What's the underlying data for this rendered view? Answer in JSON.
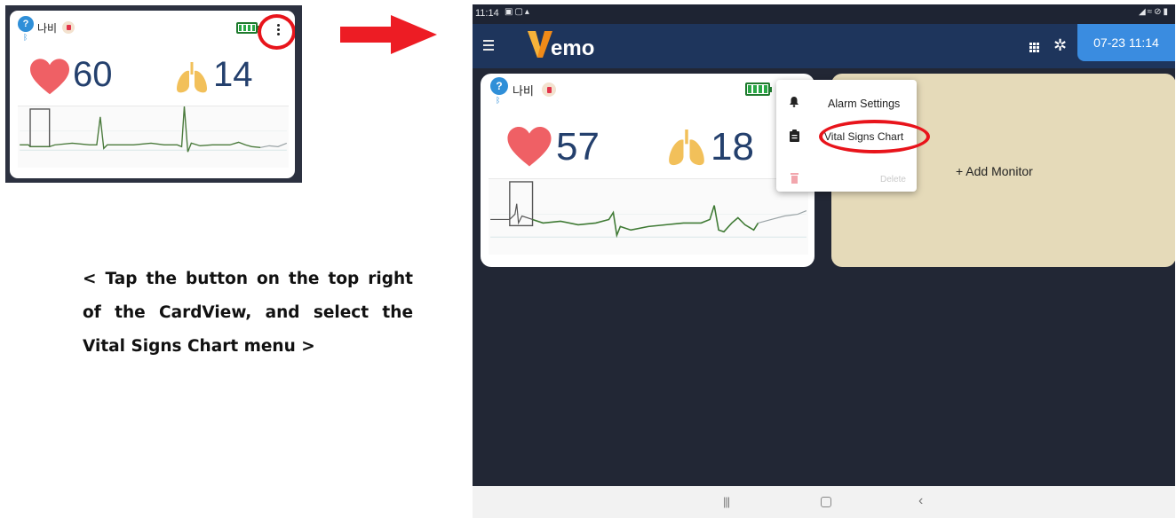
{
  "small_card": {
    "patient_name": "나비",
    "heart_rate": "60",
    "respiration_rate": "14"
  },
  "instruction_text": "< Tap the button on the top right of the CardView, and select the Vital Signs Chart menu >",
  "tablet": {
    "status_time": "11:14",
    "app_name": "emo",
    "date_time": "07-23 11:14",
    "card": {
      "patient_name": "나비",
      "heart_rate": "57",
      "respiration_rate": "18"
    },
    "menu": {
      "items": [
        {
          "label": "Alarm Settings",
          "icon": "bell-icon"
        },
        {
          "label": "Vital Signs Chart",
          "icon": "clipboard-icon"
        },
        {
          "label": "Delete",
          "icon": "trash-icon"
        }
      ]
    },
    "add_monitor_label": "+ Add Monitor"
  },
  "colors": {
    "highlight": "#e8141b",
    "heart": "#ef6065",
    "lungs": "#f2c05a",
    "app_bar": "#1e355c",
    "date_badge": "#3a8ce0",
    "add_card": "#e5dab9"
  }
}
